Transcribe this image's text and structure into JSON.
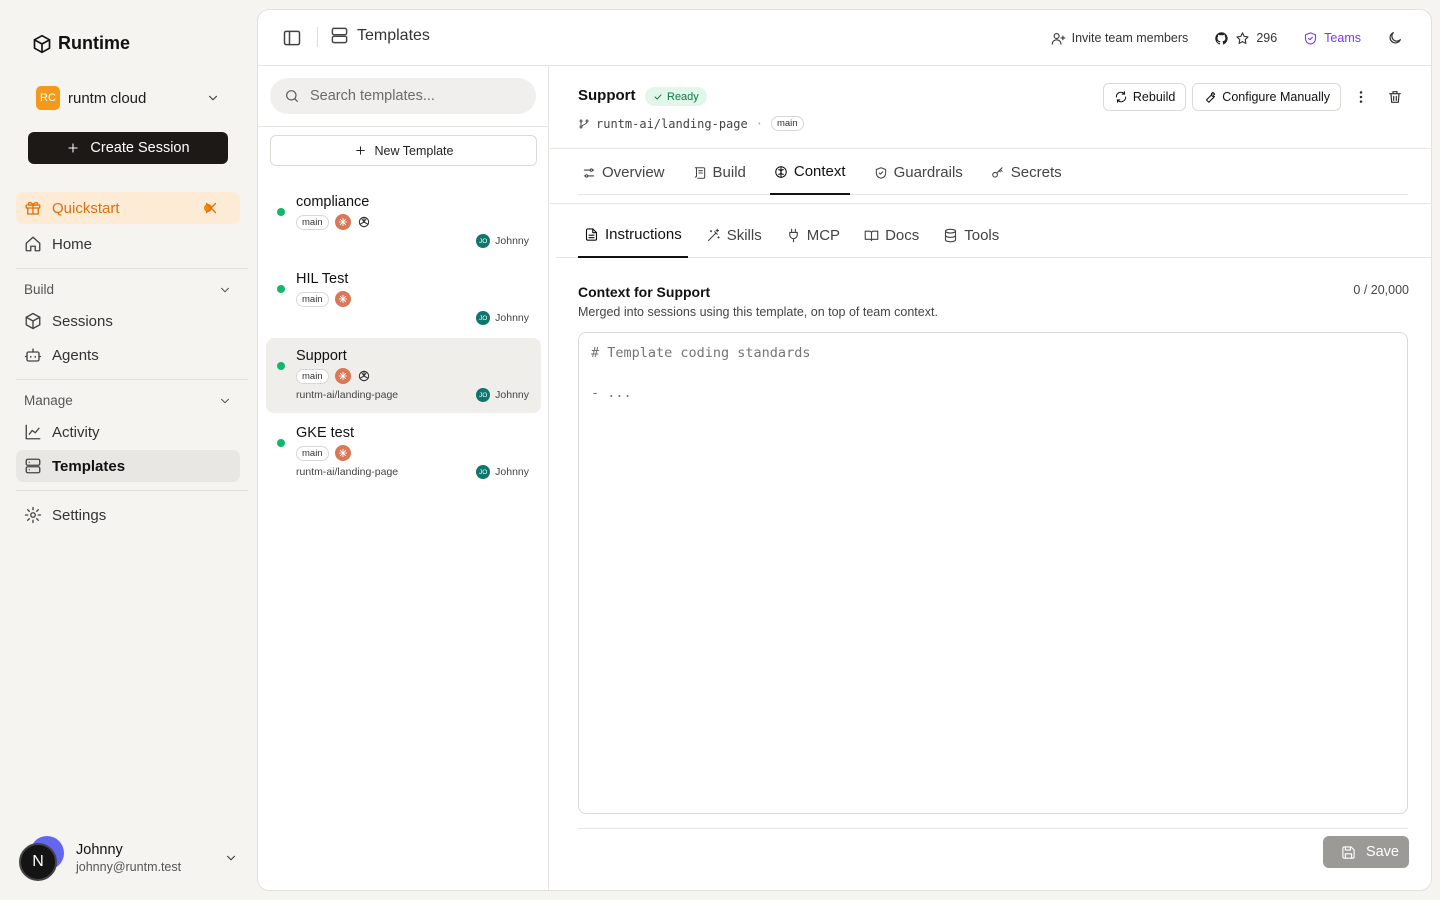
{
  "sidebar": {
    "brand": "Runtime",
    "org": {
      "initials": "RC",
      "name": "runtm cloud"
    },
    "create_label": "Create Session",
    "quickstart": "Quickstart",
    "home": "Home",
    "build_label": "Build",
    "sessions": "Sessions",
    "agents": "Agents",
    "manage_label": "Manage",
    "activity": "Activity",
    "templates": "Templates",
    "settings": "Settings",
    "user": {
      "initial": "N",
      "name": "Johnny",
      "email": "johnny@runtm.test"
    }
  },
  "topbar": {
    "breadcrumb": "Templates",
    "invite": "Invite team members",
    "stars": "296",
    "teams": "Teams"
  },
  "list": {
    "search_placeholder": "Search templates...",
    "new_label": "New Template",
    "templates": [
      {
        "name": "compliance",
        "branch": "main",
        "repo": "",
        "author_initials": "JO",
        "author": "Johnny"
      },
      {
        "name": "HIL Test",
        "branch": "main",
        "repo": "",
        "author_initials": "JO",
        "author": "Johnny"
      },
      {
        "name": "Support",
        "branch": "main",
        "repo": "runtm-ai/landing-page",
        "author_initials": "JO",
        "author": "Johnny"
      },
      {
        "name": "GKE test",
        "branch": "main",
        "repo": "runtm-ai/landing-page",
        "author_initials": "JO",
        "author": "Johnny"
      }
    ]
  },
  "detail": {
    "title": "Support",
    "status": "Ready",
    "repo": "runtm-ai/landing-page",
    "branch": "main",
    "rebuild": "Rebuild",
    "configure": "Configure Manually",
    "tabs": [
      "Overview",
      "Build",
      "Context",
      "Guardrails",
      "Secrets"
    ],
    "subtabs": [
      "Instructions",
      "Skills",
      "MCP",
      "Docs",
      "Tools"
    ],
    "context_title": "Context for Support",
    "context_count": "0 / 20,000",
    "context_desc": "Merged into sessions using this template, on top of team context.",
    "editor_placeholder": "# Template coding standards\n\n- ...",
    "save": "Save"
  },
  "colors": {
    "accent_orange": "#e0700a",
    "status_green": "#12b76a",
    "teams_purple": "#7c3aed",
    "primary_dark": "#1c1917"
  }
}
